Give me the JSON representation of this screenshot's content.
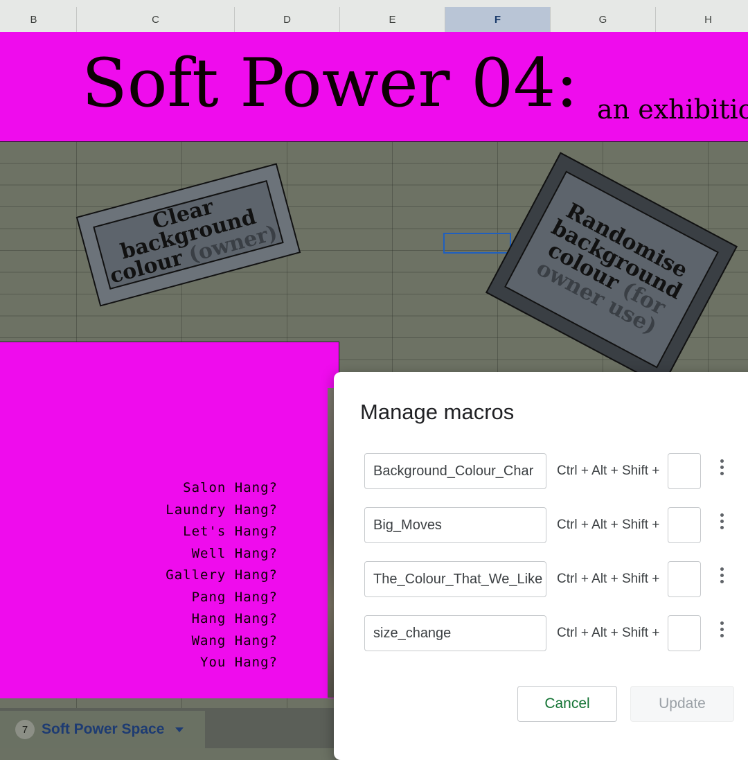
{
  "columns": [
    {
      "label": "B",
      "active": false
    },
    {
      "label": "C",
      "active": false
    },
    {
      "label": "D",
      "active": false
    },
    {
      "label": "E",
      "active": false
    },
    {
      "label": "F",
      "active": true
    },
    {
      "label": "G",
      "active": false
    },
    {
      "label": "H",
      "active": false
    }
  ],
  "banner": {
    "title": "Soft Power 04:",
    "subtitle": "an exhibitio",
    "color": "#ef0ced"
  },
  "buttons": {
    "clear": {
      "main": "Clear background colour",
      "muted": "(owner)"
    },
    "randomise": {
      "main": "Randomise background colour",
      "muted": "(for owner use)"
    }
  },
  "hang_list": [
    "Salon Hang?",
    "Laundry Hang?",
    "Let's Hang?",
    "Well Hang?",
    "Gallery Hang?",
    "Pang Hang?",
    "Hang Hang?",
    "Wang Hang?",
    "You Hang?"
  ],
  "sheet_tab": {
    "badge": "7",
    "label": "Soft Power Space",
    "icon": "caret-down-icon"
  },
  "dialog": {
    "title": "Manage macros",
    "macros": [
      {
        "name": "Background_Colour_Char",
        "shortcut": "Ctrl + Alt + Shift +",
        "key": ""
      },
      {
        "name": "Big_Moves",
        "shortcut": "Ctrl + Alt + Shift +",
        "key": ""
      },
      {
        "name": "The_Colour_That_We_Like",
        "shortcut": "Ctrl + Alt + Shift +",
        "key": ""
      },
      {
        "name": "size_change",
        "shortcut": "Ctrl + Alt + Shift +",
        "key": ""
      }
    ],
    "cancel_label": "Cancel",
    "update_label": "Update"
  }
}
